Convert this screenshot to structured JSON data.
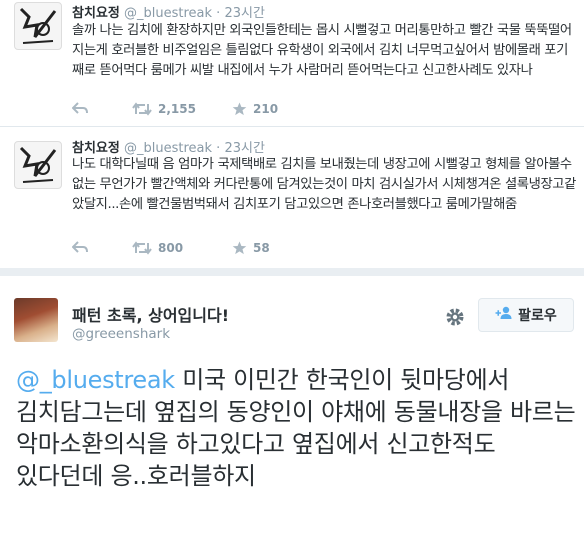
{
  "tweets": [
    {
      "name": "참치요정",
      "handle": "@_bluestreak",
      "separator": "·",
      "time": "23시간",
      "text": "솔까 나는 김치에 환장하지만 외국인들한테는 몹시 시뻘겋고 머리통만하고 빨간 국물 뚝뚝떨어지는게 호러블한 비주얼임은 틀림없다 유학생이 외국에서 김치 너무먹고싶어서 밤에몰래 포기째로 뜯어먹다 룸메가 씨발 내집에서 누가 사람머리 뜯어먹는다고 신고한사례도 있자나",
      "retweets": "2,155",
      "favorites": "210"
    },
    {
      "name": "참치요정",
      "handle": "@_bluestreak",
      "separator": "·",
      "time": "23시간",
      "text": "나도 대학다닐때 음 엄마가 국제택배로 김치를 보내줬는데 냉장고에 시뻘겋고 형체를 알아볼수없는 무언가가 빨간액체와 커다란통에 담겨있는것이 마치 검시실가서 시체챙겨온 셜록냉장고같았달지...손에 빨건물범벅돼서 김치포기 담고있으면 존나호러블했다고 룸메가말해줌",
      "retweets": "800",
      "favorites": "58"
    }
  ],
  "main_tweet": {
    "name": "패턴 초록, 상어입니다!",
    "handle": "@greeenshark",
    "follow_label": "팔로우",
    "mention": "@_bluestreak",
    "text": " 미국 이민간 한국인이 뒷마당에서 김치담그는데 옆집의 동양인이 야채에 동물내장을 바르는 악마소환의식을 하고있다고 옆집에서 신고한적도 있다던데 응..호러블하지"
  },
  "colors": {
    "link": "#55acee",
    "muted": "#8899a6",
    "text": "#292f33",
    "divider": "#e9eef2"
  },
  "icons": [
    "reply-icon",
    "retweet-icon",
    "favorite-icon",
    "gear-icon",
    "add-user-icon"
  ]
}
